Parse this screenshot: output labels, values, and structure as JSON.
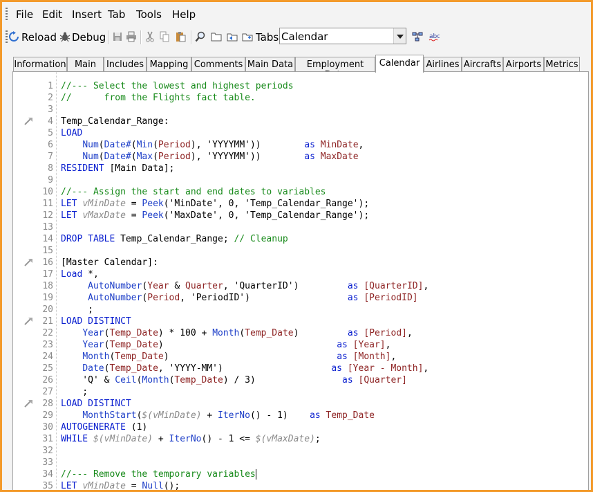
{
  "menu": [
    "File",
    "Edit",
    "Insert",
    "Tab",
    "Tools",
    "Help"
  ],
  "toolbar": {
    "reload_label": "Reload",
    "debug_label": "Debug",
    "tabs_label": "Tabs",
    "tabs_selected": "Calendar"
  },
  "tabs": [
    "Information",
    "Main",
    "Includes",
    "Mapping",
    "Comments",
    "Main Data",
    "Employment Data",
    "Calendar",
    "Airlines",
    "Aircrafts",
    "Airports",
    "Metrics"
  ],
  "active_tab": "Calendar",
  "colors": {
    "frame_border": "#f39a2b",
    "comment": "#178a1a",
    "keyword": "#0a1fcf",
    "function": "#1e3fc8",
    "field": "#8e2424",
    "variable": "#8a8a8a"
  },
  "code": {
    "bookmarked_lines": [
      4,
      16,
      21,
      28
    ],
    "lines": [
      {
        "n": "1",
        "segs": [
          [
            "c",
            "//--- Select the lowest and highest periods"
          ]
        ]
      },
      {
        "n": "2",
        "segs": [
          [
            "c",
            "//      from the Flights fact table."
          ]
        ]
      },
      {
        "n": "3",
        "segs": []
      },
      {
        "n": "4",
        "segs": [
          [
            "t",
            "Temp_Calendar_Range:"
          ]
        ]
      },
      {
        "n": "5",
        "segs": [
          [
            "k",
            "LOAD"
          ]
        ]
      },
      {
        "n": "6",
        "segs": [
          [
            "t",
            "    "
          ],
          [
            "f",
            "Num"
          ],
          [
            "t",
            "("
          ],
          [
            "f",
            "Date#"
          ],
          [
            "t",
            "("
          ],
          [
            "f",
            "Min"
          ],
          [
            "t",
            "("
          ],
          [
            "fd",
            "Period"
          ],
          [
            "t",
            "), "
          ],
          [
            "s",
            "'YYYYMM'"
          ],
          [
            "t",
            "))        "
          ],
          [
            "k",
            "as"
          ],
          [
            "t",
            " "
          ],
          [
            "fd",
            "MinDate"
          ],
          [
            "t",
            ","
          ]
        ]
      },
      {
        "n": "7",
        "segs": [
          [
            "t",
            "    "
          ],
          [
            "f",
            "Num"
          ],
          [
            "t",
            "("
          ],
          [
            "f",
            "Date#"
          ],
          [
            "t",
            "("
          ],
          [
            "f",
            "Max"
          ],
          [
            "t",
            "("
          ],
          [
            "fd",
            "Period"
          ],
          [
            "t",
            "), "
          ],
          [
            "s",
            "'YYYYMM'"
          ],
          [
            "t",
            "))        "
          ],
          [
            "k",
            "as"
          ],
          [
            "t",
            " "
          ],
          [
            "fd",
            "MaxDate"
          ]
        ]
      },
      {
        "n": "8",
        "segs": [
          [
            "k",
            "RESIDENT"
          ],
          [
            "t",
            " [Main Data];"
          ]
        ]
      },
      {
        "n": "9",
        "segs": []
      },
      {
        "n": "10",
        "segs": [
          [
            "c",
            "//--- Assign the start and end dates to variables"
          ]
        ]
      },
      {
        "n": "11",
        "segs": [
          [
            "k",
            "LET"
          ],
          [
            "t",
            " "
          ],
          [
            "v",
            "vMinDate"
          ],
          [
            "t",
            " = "
          ],
          [
            "f",
            "Peek"
          ],
          [
            "t",
            "('MinDate', 0, 'Temp_Calendar_Range');"
          ]
        ]
      },
      {
        "n": "12",
        "segs": [
          [
            "k",
            "LET"
          ],
          [
            "t",
            " "
          ],
          [
            "v",
            "vMaxDate"
          ],
          [
            "t",
            " = "
          ],
          [
            "f",
            "Peek"
          ],
          [
            "t",
            "('MaxDate', 0, 'Temp_Calendar_Range');"
          ]
        ]
      },
      {
        "n": "13",
        "segs": []
      },
      {
        "n": "14",
        "segs": [
          [
            "k",
            "DROP TABLE"
          ],
          [
            "t",
            " Temp_Calendar_Range; "
          ],
          [
            "c",
            "// Cleanup"
          ]
        ]
      },
      {
        "n": "15",
        "segs": []
      },
      {
        "n": "16",
        "segs": [
          [
            "t",
            "[Master Calendar]:"
          ]
        ]
      },
      {
        "n": "17",
        "segs": [
          [
            "k",
            "Load"
          ],
          [
            "t",
            " *,"
          ]
        ]
      },
      {
        "n": "18",
        "segs": [
          [
            "t",
            "     "
          ],
          [
            "f",
            "AutoNumber"
          ],
          [
            "t",
            "("
          ],
          [
            "fd",
            "Year"
          ],
          [
            "t",
            " & "
          ],
          [
            "fd",
            "Quarter"
          ],
          [
            "t",
            ", 'QuarterID')         "
          ],
          [
            "k",
            "as"
          ],
          [
            "t",
            " "
          ],
          [
            "fd",
            "[QuarterID]"
          ],
          [
            "t",
            ","
          ]
        ]
      },
      {
        "n": "19",
        "segs": [
          [
            "t",
            "     "
          ],
          [
            "f",
            "AutoNumber"
          ],
          [
            "t",
            "("
          ],
          [
            "fd",
            "Period"
          ],
          [
            "t",
            ", 'PeriodID')                  "
          ],
          [
            "k",
            "as"
          ],
          [
            "t",
            " "
          ],
          [
            "fd",
            "[PeriodID]"
          ]
        ]
      },
      {
        "n": "20",
        "segs": [
          [
            "t",
            "     ;"
          ]
        ]
      },
      {
        "n": "21",
        "segs": [
          [
            "k",
            "LOAD DISTINCT"
          ]
        ]
      },
      {
        "n": "22",
        "segs": [
          [
            "t",
            "    "
          ],
          [
            "f",
            "Year"
          ],
          [
            "t",
            "("
          ],
          [
            "fd",
            "Temp_Date"
          ],
          [
            "t",
            ") * 100 + "
          ],
          [
            "f",
            "Month"
          ],
          [
            "t",
            "("
          ],
          [
            "fd",
            "Temp_Date"
          ],
          [
            "t",
            ")         "
          ],
          [
            "k",
            "as"
          ],
          [
            "t",
            " "
          ],
          [
            "fd",
            "[Period]"
          ],
          [
            "t",
            ","
          ]
        ]
      },
      {
        "n": "23",
        "segs": [
          [
            "t",
            "    "
          ],
          [
            "f",
            "Year"
          ],
          [
            "t",
            "("
          ],
          [
            "fd",
            "Temp_Date"
          ],
          [
            "t",
            ")                                "
          ],
          [
            "k",
            "as"
          ],
          [
            "t",
            " "
          ],
          [
            "fd",
            "[Year]"
          ],
          [
            "t",
            ","
          ]
        ]
      },
      {
        "n": "24",
        "segs": [
          [
            "t",
            "    "
          ],
          [
            "f",
            "Month"
          ],
          [
            "t",
            "("
          ],
          [
            "fd",
            "Temp_Date"
          ],
          [
            "t",
            ")                               "
          ],
          [
            "k",
            "as"
          ],
          [
            "t",
            " "
          ],
          [
            "fd",
            "[Month]"
          ],
          [
            "t",
            ","
          ]
        ]
      },
      {
        "n": "25",
        "segs": [
          [
            "t",
            "    "
          ],
          [
            "f",
            "Date"
          ],
          [
            "t",
            "("
          ],
          [
            "fd",
            "Temp_Date"
          ],
          [
            "t",
            ", 'YYYY-MM')                    "
          ],
          [
            "k",
            "as"
          ],
          [
            "t",
            " "
          ],
          [
            "fd",
            "[Year - Month]"
          ],
          [
            "t",
            ","
          ]
        ]
      },
      {
        "n": "26",
        "segs": [
          [
            "t",
            "    'Q' & "
          ],
          [
            "f",
            "Ceil"
          ],
          [
            "t",
            "("
          ],
          [
            "f",
            "Month"
          ],
          [
            "t",
            "("
          ],
          [
            "fd",
            "Temp_Date"
          ],
          [
            "t",
            ") / 3)                "
          ],
          [
            "k",
            "as"
          ],
          [
            "t",
            " "
          ],
          [
            "fd",
            "[Quarter]"
          ]
        ]
      },
      {
        "n": "27",
        "segs": [
          [
            "t",
            "    ;"
          ]
        ]
      },
      {
        "n": "28",
        "segs": [
          [
            "k",
            "LOAD DISTINCT"
          ]
        ]
      },
      {
        "n": "29",
        "segs": [
          [
            "t",
            "    "
          ],
          [
            "f",
            "MonthStart"
          ],
          [
            "t",
            "("
          ],
          [
            "v",
            "$(vMinDate)"
          ],
          [
            "t",
            " + "
          ],
          [
            "f",
            "IterNo"
          ],
          [
            "t",
            "() - 1)    "
          ],
          [
            "k",
            "as"
          ],
          [
            "t",
            " "
          ],
          [
            "fd",
            "Temp_Date"
          ]
        ]
      },
      {
        "n": "30",
        "segs": [
          [
            "k",
            "AUTOGENERATE"
          ],
          [
            "t",
            " (1)"
          ]
        ]
      },
      {
        "n": "31",
        "segs": [
          [
            "k",
            "WHILE"
          ],
          [
            "t",
            " "
          ],
          [
            "v",
            "$(vMinDate)"
          ],
          [
            "t",
            " + "
          ],
          [
            "f",
            "IterNo"
          ],
          [
            "t",
            "() - 1 <= "
          ],
          [
            "v",
            "$(vMaxDate)"
          ],
          [
            "t",
            ";"
          ]
        ]
      },
      {
        "n": "32",
        "segs": []
      },
      {
        "n": "33",
        "segs": []
      },
      {
        "n": "34",
        "segs": [
          [
            "c",
            "//--- Remove the temporary variables"
          ]
        ]
      },
      {
        "n": "35",
        "segs": [
          [
            "k",
            "LET"
          ],
          [
            "t",
            " "
          ],
          [
            "v",
            "vMinDate"
          ],
          [
            "t",
            " = "
          ],
          [
            "f",
            "Null"
          ],
          [
            "t",
            "();"
          ]
        ]
      }
    ]
  }
}
